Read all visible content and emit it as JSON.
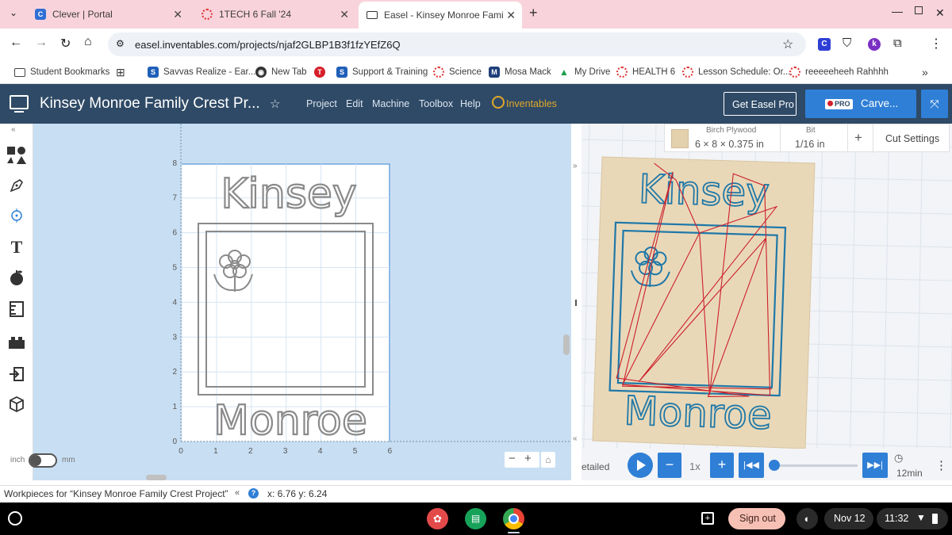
{
  "tabs": [
    {
      "label": "Clever | Portal"
    },
    {
      "label": "1TECH 6 Fall '24"
    },
    {
      "label": "Easel - Kinsey Monroe Family C"
    }
  ],
  "url": "easel.inventables.com/projects/njaf2GLBP1B3f1fzYEfZ6Q",
  "bookmarks": [
    {
      "label": "Student Bookmarks"
    },
    {
      "label": "Savvas Realize - Ear..."
    },
    {
      "label": "New Tab"
    },
    {
      "label": "Support & Training"
    },
    {
      "label": "Science"
    },
    {
      "label": "Mosa Mack"
    },
    {
      "label": "My Drive"
    },
    {
      "label": "HEALTH 6"
    },
    {
      "label": "Lesson Schedule: Or..."
    },
    {
      "label": "reeeeeheeh Rahhhh"
    }
  ],
  "app": {
    "title": "Kinsey Monroe Family Crest Pr...",
    "menu": [
      "Project",
      "Edit",
      "Machine",
      "Toolbox",
      "Help"
    ],
    "brand": "Inventables",
    "get_pro": "Get Easel Pro",
    "pro_badge": "PRO",
    "carve": "Carve..."
  },
  "design": {
    "top_text": "Kinsey",
    "bottom_text": "Monroe",
    "x_ticks": [
      "0",
      "1",
      "2",
      "3",
      "4",
      "5",
      "6"
    ],
    "y_ticks": [
      "0",
      "1",
      "2",
      "3",
      "4",
      "5",
      "6",
      "7",
      "8"
    ],
    "unit_inch": "inch",
    "unit_mm": "mm"
  },
  "preview": {
    "material_name": "Birch Plywood",
    "material_size": "6 × 8 × 0.375 in",
    "bit_label": "Bit",
    "bit_value": "1/16 in",
    "cut_settings": "Cut Settings",
    "detail_label": "etailed",
    "speed": "1x",
    "time": "12min",
    "top_text": "Kinsey",
    "bottom_text": "Monroe"
  },
  "status": {
    "workpieces": "Workpieces for “Kinsey Monroe Family Crest Project”",
    "coords": "x: 6.76 y: 6.24"
  },
  "shelf": {
    "signout": "Sign out",
    "date": "Nov 12",
    "time": "11:32"
  },
  "colors": {
    "header": "#2f4a66",
    "carve_button": "#2f7fd6",
    "canvas_bg": "#c8def2",
    "wood": "#e9d8b8",
    "toolpath_red": "#cc1f2a",
    "toolpath_blue": "#1f78a8"
  }
}
